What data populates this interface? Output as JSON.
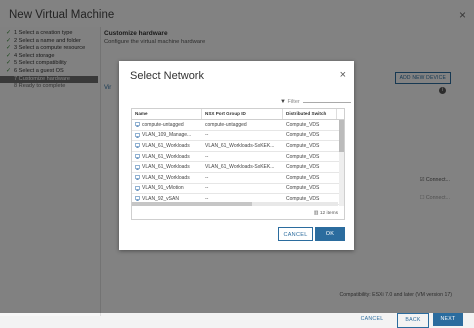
{
  "window": {
    "title": "New Virtual Machine",
    "close_glyph": "×"
  },
  "steps": [
    {
      "label": "1 Select a creation type",
      "done": true
    },
    {
      "label": "2 Select a name and folder",
      "done": true
    },
    {
      "label": "3 Select a compute resource",
      "done": true
    },
    {
      "label": "4 Select storage",
      "done": true
    },
    {
      "label": "5 Select compatibility",
      "done": true
    },
    {
      "label": "6 Select a guest OS",
      "done": true
    },
    {
      "label": "7 Customize hardware",
      "done": false,
      "active": true
    },
    {
      "label": "8 Ready to complete",
      "done": false
    }
  ],
  "main": {
    "title": "Customize hardware",
    "subtitle": "Configure the virtual machine hardware",
    "tab_label": "Vir",
    "add_device": "ADD NEW DEVICE",
    "connect_label": "Connect...",
    "connect_label2": "Connect...",
    "compatibility": "Compatibility: ESXi 7.0 and later (VM version 17)",
    "buttons": {
      "cancel": "CANCEL",
      "back": "BACK",
      "next": "NEXT"
    }
  },
  "dialog": {
    "title": "Select Network",
    "close_glyph": "×",
    "filter_label": "Filter",
    "columns": [
      "Name",
      "NSX Port Group ID",
      "Distributed Switch"
    ],
    "rows": [
      {
        "name": "compute-untagged",
        "port_group": "compute-untagged",
        "switch": "Compute_VDS"
      },
      {
        "name": "VLAN_109_Manage...",
        "port_group": "--",
        "switch": "Compute_VDS"
      },
      {
        "name": "VLAN_61_Workloads",
        "port_group": "VLAN_61_Workloads-SxKEK...",
        "switch": "Compute_VDS"
      },
      {
        "name": "VLAN_61_Workloads",
        "port_group": "--",
        "switch": "Compute_VDS"
      },
      {
        "name": "VLAN_61_Workloads",
        "port_group": "VLAN_61_Workloads-SxKEK...",
        "switch": "Compute_VDS"
      },
      {
        "name": "VLAN_62_Workloads",
        "port_group": "--",
        "switch": "Compute_VDS"
      },
      {
        "name": "VLAN_91_vMotion",
        "port_group": "--",
        "switch": "Compute_VDS"
      },
      {
        "name": "VLAN_92_vSAN",
        "port_group": "--",
        "switch": "Compute_VDS"
      }
    ],
    "item_count": "12 items",
    "cancel_label": "CANCEL",
    "ok_label": "OK"
  },
  "colors": {
    "accent": "#2b6c9e",
    "step_check": "#3a8a3a",
    "net_icon": "#4a7fb5"
  }
}
